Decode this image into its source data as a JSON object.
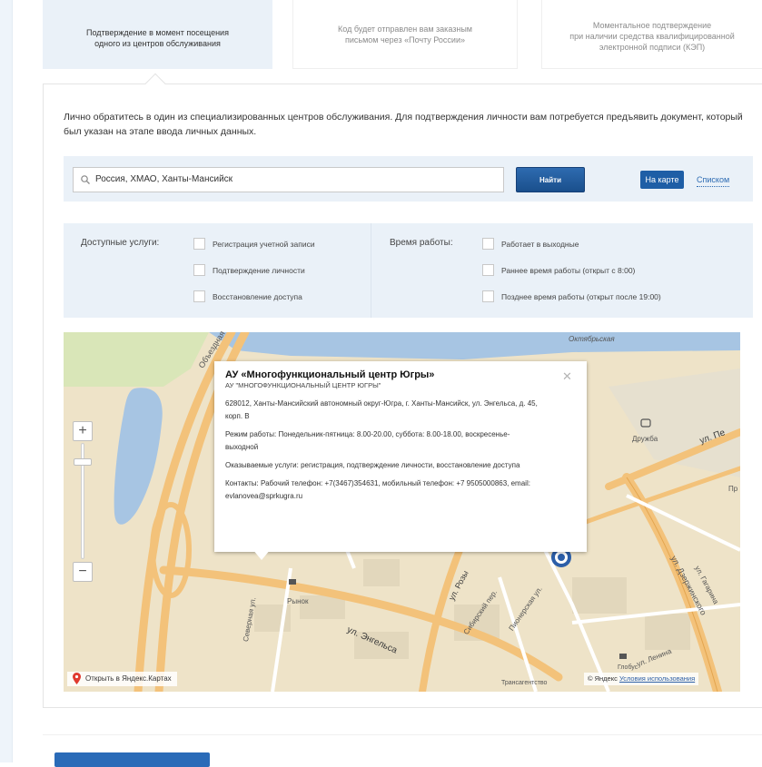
{
  "tabs": [
    {
      "line1": "Подтверждение в момент посещения",
      "line2": "одного из центров обслуживания",
      "active": true
    },
    {
      "line1": "Код будет отправлен вам заказным",
      "line2": "письмом через «Почту России»",
      "active": false
    },
    {
      "line1": "Моментальное подтверждение",
      "line2": "при наличии средства квалифицированной",
      "line3": "электронной подписи (КЭП)",
      "active": false
    }
  ],
  "intro": "Лично обратитесь в один из специализированных центров обслуживания. Для подтверждения личности вам потребуется предъявить документ, который был указан на этапе ввода личных данных.",
  "search": {
    "value": "Россия, ХМАО, Ханты-Мансийск",
    "button": "Найти",
    "view_map": "На карте",
    "view_list": "Списком"
  },
  "filters": {
    "services_label": "Доступные услуги:",
    "services": [
      "Регистрация учетной записи",
      "Подтверждение личности",
      "Восстановление доступа"
    ],
    "hours_label": "Время работы:",
    "hours": [
      "Работает в выходные",
      "Раннее время работы (открыт с 8:00)",
      "Позднее время работы (открыт после 19:00)"
    ]
  },
  "balloon": {
    "title": "АУ «Многофункциональный центр Югры»",
    "subtitle": "АУ \"МНОГОФУНКЦИОНАЛЬНЫЙ ЦЕНТР ЮГРЫ\"",
    "address": "628012, Ханты-Мансийский автономный округ-Югра, г. Ханты-Мансийск, ул. Энгельса, д. 45, корп. В",
    "schedule": "Режим работы: Понедельник-пятница: 8.00-20.00, суббота: 8.00-18.00, воскресенье-выходной",
    "services": "Оказываемые услуги: регистрация, подтверждение личности, восстановление доступа",
    "contacts": "Контакты: Рабочий телефон: +7(3467)354631, мобильный телефон: +7 9505000863, email: evlanovea@sprkugra.ru"
  },
  "map_labels": {
    "obezdnaya": "Объездная",
    "oktyabrskaya": "Октябрьская",
    "druzhba": "Дружба",
    "ul_pe": "ул. Пе",
    "rozy": "ул. Розы",
    "sibirsky": "Сибирский пер.",
    "pionerskaya": "Пионерская ул.",
    "engelsa": "ул. Энгельса",
    "severnaya": "Северная ул.",
    "dzerzhinskogo": "ул. Дзержинского",
    "gagarina": "ул. Гагарина",
    "lenina": "ул. Ленина",
    "rynok": "Рынок",
    "transagentstvo": "Трансагентство",
    "globus": "Глобус",
    "pr": "Пр",
    "zoom_plus": "+",
    "zoom_minus": "−"
  },
  "map_footer": {
    "open_in": "Открыть в Яндекс.Картах",
    "copyright": "© Яндекс",
    "terms": "Условия использования"
  },
  "colors": {
    "accent_blue": "#1e5ea6",
    "panel_bg": "#eaf1f8",
    "road_orange": "#f3c27a",
    "water": "#a7c5e3",
    "marker": "#2c5ea8"
  }
}
